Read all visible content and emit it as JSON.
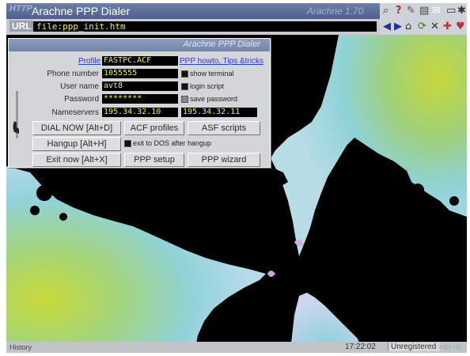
{
  "window": {
    "brand_text": "HTTP",
    "title": "Arachne PPP Dialer",
    "title_right": "Arachne 1.70"
  },
  "urlbar": {
    "label": "URL",
    "value": "file:ppp_init.htm"
  },
  "dialog": {
    "title": "Arachne PPP Dialer",
    "profile_label": "Profile",
    "profile_value": "FASTPC.ACF",
    "howto_link": "PPP howto, Tips &tricks",
    "phone_label": "Phone number",
    "phone_value": "1055555",
    "username_label": "User name",
    "username_value": "avt8",
    "password_label": "Password",
    "password_value": "********",
    "nameservers_label": "Nameservers",
    "dns1": "195.34.32.10",
    "dns2": "195.34.32.11",
    "opt_show_terminal": "show terminal",
    "opt_login_script": "login script",
    "opt_save_password": "save password",
    "opt_exit_dos": "exit to DOS after hangup",
    "btn_dial": "DIAL NOW [Alt+D]",
    "btn_acf": "ACF profiles",
    "btn_asf": "ASF scripts",
    "btn_hangup": "Hangup [Alt+H]",
    "btn_exit": "Exit now [Alt+X]",
    "btn_setup": "PPP setup",
    "btn_wizard": "PPP wizard"
  },
  "status": {
    "left": "History",
    "time": "17:22:02",
    "registration": "Unregistered",
    "right": "sign up"
  },
  "colors": {
    "field_text": "#e7f25a",
    "titlebar": "#5a6a98",
    "link": "#2a3bd0"
  }
}
